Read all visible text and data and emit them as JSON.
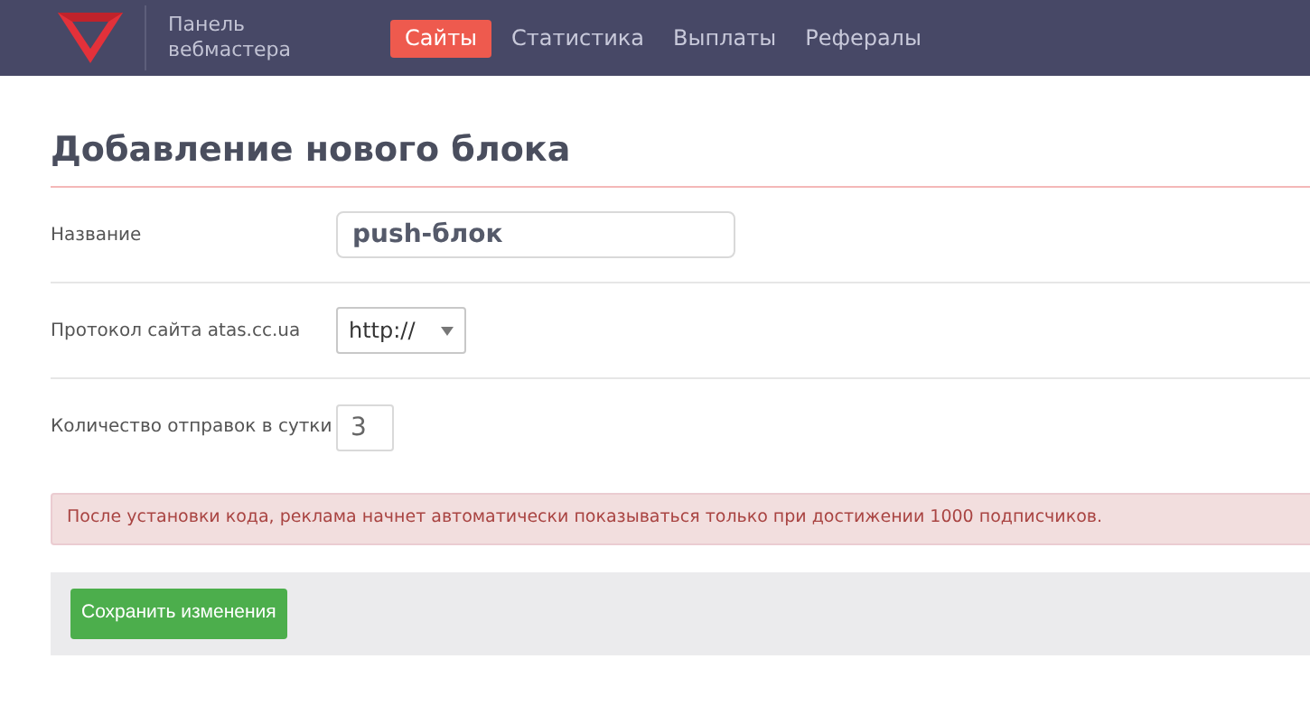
{
  "header": {
    "brand": [
      "Панель",
      "вебмастера"
    ],
    "nav": [
      {
        "label": "Сайты",
        "selected": true
      },
      {
        "label": "Статистика",
        "selected": false
      },
      {
        "label": "Выплаты",
        "selected": false
      },
      {
        "label": "Рефералы",
        "selected": false
      }
    ]
  },
  "title": "Добавление нового блока",
  "form": [
    {
      "kind": "text",
      "label": "Название",
      "value": "push-блок"
    },
    {
      "kind": "select",
      "label": "Протокол сайта atas.cc.ua",
      "value": "http://"
    },
    {
      "kind": "number",
      "label": "Количество отправок в сутки",
      "value": "3"
    }
  ],
  "alert": "После установки кода, реклама начнет автоматически показываться только при достижении 1000 подписчиков.",
  "save_button": "Сохранить изменения"
}
